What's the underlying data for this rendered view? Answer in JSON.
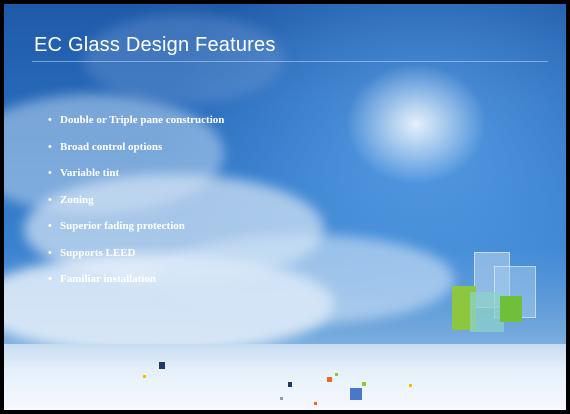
{
  "slide": {
    "title": "EC Glass Design Features",
    "bullets": [
      "Double or Triple pane construction",
      "Broad control options",
      "Variable tint",
      "Zoning",
      "Superior fading protection",
      "Supports LEED",
      "Familiar installation"
    ]
  },
  "colors": {
    "sky_top": "#1f5aa8",
    "sky_bottom": "#b9d3ee",
    "title_text": "#ffffff",
    "accent_green": "#8dc63f",
    "accent_orange": "#f26522",
    "accent_blue": "#4a78c8"
  }
}
